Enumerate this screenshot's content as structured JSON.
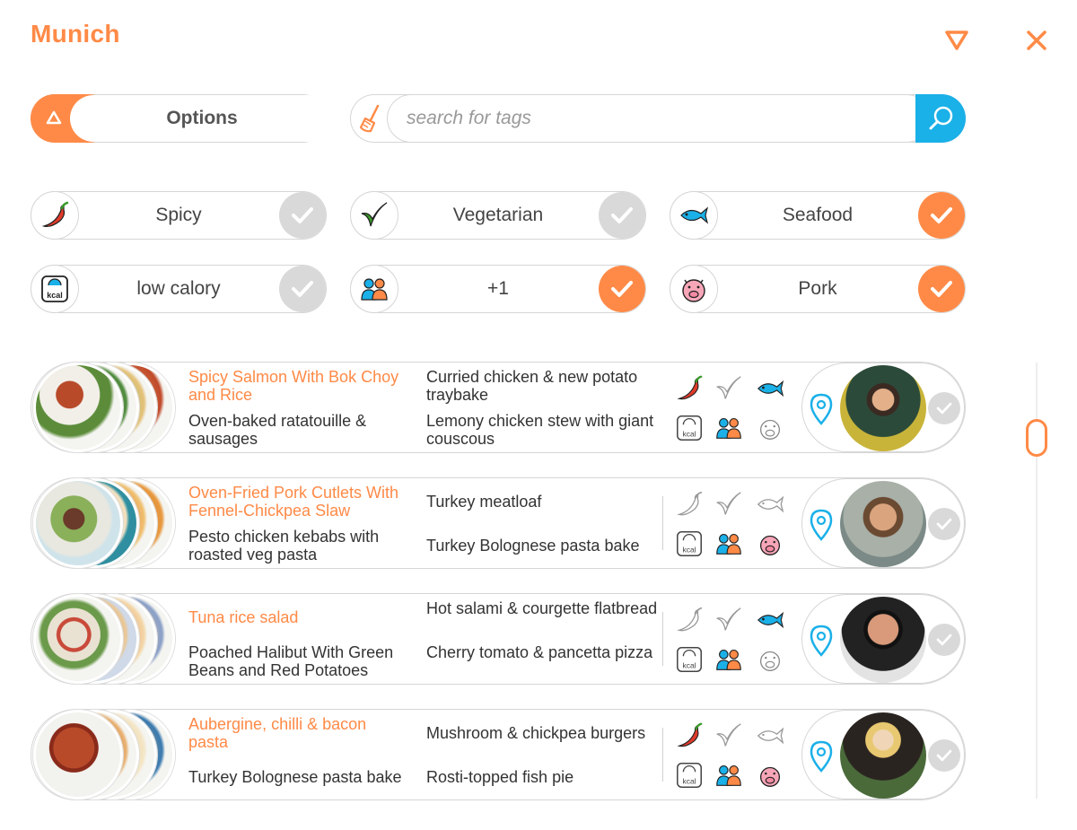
{
  "header": {
    "title": "Munich",
    "collapse_icon": "triangle-down-icon",
    "close_icon": "close-icon"
  },
  "options": {
    "label": "Options",
    "icon": "triangle-up-icon"
  },
  "search": {
    "placeholder": "search for tags",
    "clear_icon": "broom-icon",
    "go_icon": "search-icon"
  },
  "colors": {
    "accent": "#ff8a47",
    "search_blue": "#1ab0e8",
    "check_off": "#d9d9d9"
  },
  "filters": [
    {
      "label": "Spicy",
      "icon": "chili-icon",
      "checked": false
    },
    {
      "label": "Vegetarian",
      "icon": "leaf-check-icon",
      "checked": false
    },
    {
      "label": "Seafood",
      "icon": "fish-icon",
      "checked": true
    },
    {
      "label": "low calory",
      "icon": "kcal-scale-icon",
      "checked": false
    },
    {
      "label": "+1",
      "icon": "people-icon",
      "checked": true
    },
    {
      "label": "Pork",
      "icon": "pig-icon",
      "checked": true
    }
  ],
  "rows": [
    {
      "meals": [
        "Spicy Salmon With Bok Choy and Rice",
        "Oven-baked ratatouille & sausages",
        "Curried chicken & new potato traybake",
        "Lemony chicken stew with giant couscous"
      ],
      "tags": {
        "spicy": true,
        "vegetarian": false,
        "seafood": true,
        "kcal": true,
        "people": true,
        "pork": false
      }
    },
    {
      "meals": [
        "Oven-Fried Pork Cutlets With Fennel-Chickpea Slaw",
        "Pesto chicken kebabs with roasted veg pasta",
        "Turkey meatloaf",
        "Turkey Bolognese pasta bake"
      ],
      "tags": {
        "spicy": false,
        "vegetarian": false,
        "seafood": false,
        "kcal": true,
        "people": true,
        "pork": true
      }
    },
    {
      "meals": [
        "Tuna rice salad",
        "Poached Halibut With Green Beans and Red Potatoes",
        "Hot salami & courgette flatbread",
        "Cherry tomato & pancetta pizza"
      ],
      "tags": {
        "spicy": false,
        "vegetarian": false,
        "seafood": true,
        "kcal": true,
        "people": true,
        "pork": false
      }
    },
    {
      "meals": [
        "Aubergine, chilli & bacon pasta",
        "Turkey Bolognese pasta bake",
        "Mushroom & chickpea burgers",
        "Rosti-topped fish pie"
      ],
      "tags": {
        "spicy": true,
        "vegetarian": false,
        "seafood": false,
        "kcal": true,
        "people": true,
        "pork": true
      }
    }
  ],
  "kcal_text": "kcal"
}
